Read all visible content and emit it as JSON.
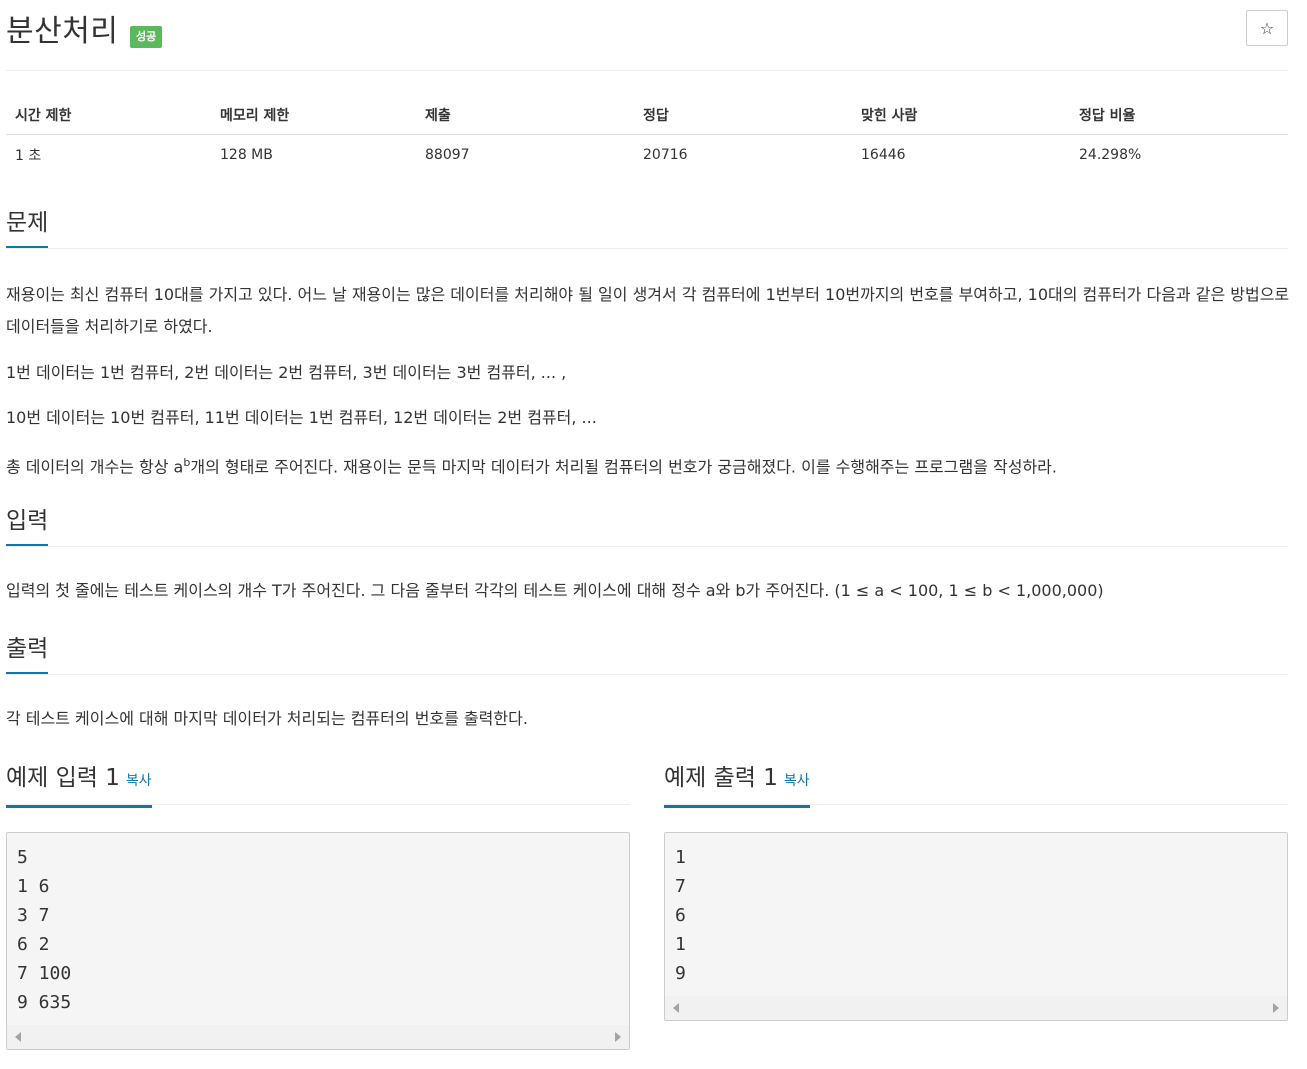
{
  "problem": {
    "title": "분산처리",
    "status_badge": "성공",
    "star_icon": "☆"
  },
  "info_table": {
    "headers": [
      "시간 제한",
      "메모리 제한",
      "제출",
      "정답",
      "맞힌 사람",
      "정답 비율"
    ],
    "values": [
      "1 초",
      "128 MB",
      "88097",
      "20716",
      "16446",
      "24.298%"
    ]
  },
  "sections": {
    "description": {
      "heading": "문제",
      "paragraphs": [
        "재용이는 최신 컴퓨터 10대를 가지고 있다. 어느 날 재용이는 많은 데이터를 처리해야 될 일이 생겨서 각 컴퓨터에 1번부터 10번까지의 번호를 부여하고, 10대의 컴퓨터가 다음과 같은 방법으로 데이터들을 처리하기로 하였다.",
        "1번 데이터는 1번 컴퓨터, 2번 데이터는 2번 컴퓨터, 3번 데이터는 3번 컴퓨터, ... ,",
        "10번 데이터는 10번 컴퓨터, 11번 데이터는 1번 컴퓨터, 12번 데이터는 2번 컴퓨터, ..."
      ],
      "last_paragraph": {
        "before": "총 데이터의 개수는 항상 a",
        "sup": "b",
        "after": "개의 형태로 주어진다. 재용이는 문득 마지막 데이터가 처리될 컴퓨터의 번호가 궁금해졌다. 이를 수행해주는 프로그램을 작성하라."
      }
    },
    "input": {
      "heading": "입력",
      "text": "입력의 첫 줄에는 테스트 케이스의 개수 T가 주어진다. 그 다음 줄부터 각각의 테스트 케이스에 대해 정수 a와 b가 주어진다. (1 ≤ a < 100, 1 ≤ b < 1,000,000)"
    },
    "output": {
      "heading": "출력",
      "text": "각 테스트 케이스에 대해 마지막 데이터가 처리되는 컴퓨터의 번호를 출력한다."
    }
  },
  "samples": {
    "input": {
      "heading": "예제 입력 1",
      "copy_label": "복사",
      "content": "5\n1 6\n3 7\n6 2\n7 100\n9 635"
    },
    "output": {
      "heading": "예제 출력 1",
      "copy_label": "복사",
      "content": "1\n7\n6\n1\n9"
    }
  },
  "colors": {
    "success_badge": "#5cb85c",
    "accent_underline": "#0e76a8",
    "code_background": "#f5f5f5"
  }
}
